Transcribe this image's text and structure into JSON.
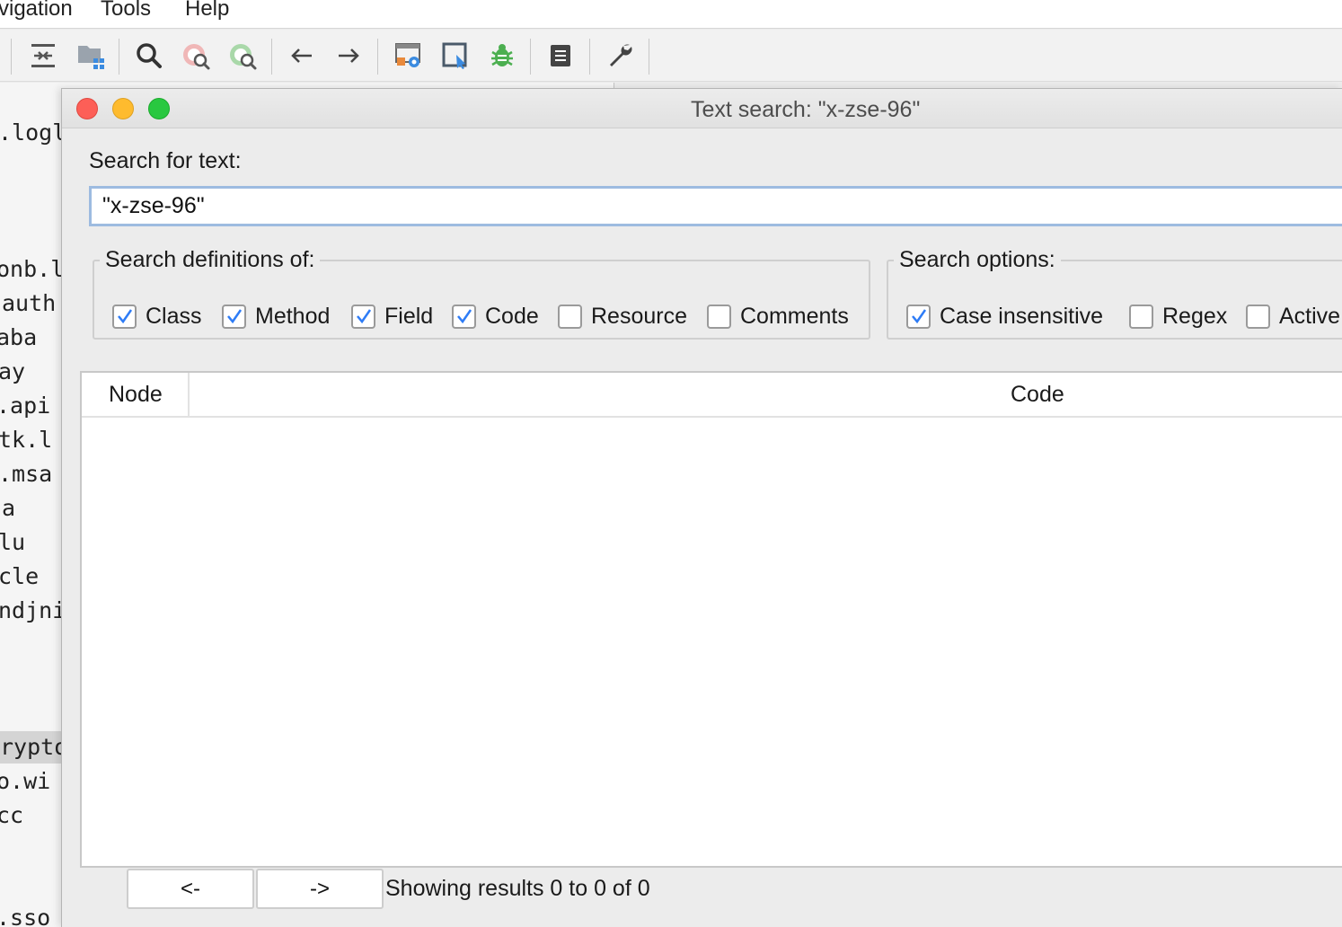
{
  "menubar": {
    "items": [
      "vigation",
      "Tools",
      "Help"
    ]
  },
  "toolbar": {
    "buttons": [
      "sync-with-editor-icon",
      "flatten-packages-icon",
      "search-icon",
      "class-search-icon",
      "usage-search-icon",
      "back-icon",
      "forward-icon",
      "deobfuscation-icon",
      "quick-tab-icon",
      "debugger-icon",
      "log-viewer-icon",
      "preferences-icon"
    ]
  },
  "tree": {
    "lines": [
      ".logl",
      "onb.l",
      "auth",
      "aba",
      "ay",
      ".api",
      "tk.l",
      ".msa",
      "a",
      "lu",
      "cle",
      "ndjni",
      "rypto",
      "o.wi",
      "cc",
      ".sso"
    ]
  },
  "dialog": {
    "title": "Text search: \"x-zse-96\"",
    "search_label": "Search for text:",
    "search_value": "\"x-zse-96\"",
    "definitions": {
      "legend": "Search definitions of:",
      "options": [
        {
          "label": "Class",
          "checked": true
        },
        {
          "label": "Method",
          "checked": true
        },
        {
          "label": "Field",
          "checked": true
        },
        {
          "label": "Code",
          "checked": true
        },
        {
          "label": "Resource",
          "checked": false
        },
        {
          "label": "Comments",
          "checked": false
        }
      ]
    },
    "search_options": {
      "legend": "Search options:",
      "options": [
        {
          "label": "Case insensitive",
          "checked": true
        },
        {
          "label": "Regex",
          "checked": false
        },
        {
          "label": "Active",
          "checked": false
        }
      ]
    },
    "table": {
      "columns": [
        "Node",
        "Code"
      ],
      "rows": []
    },
    "prev_label": "<-",
    "next_label": "->",
    "status": "Showing results 0 to 0 of 0"
  },
  "colors": {
    "accent": "#2e7cf6",
    "close": "#fd5f57",
    "minimize": "#febb2e",
    "maximize": "#29c840"
  }
}
